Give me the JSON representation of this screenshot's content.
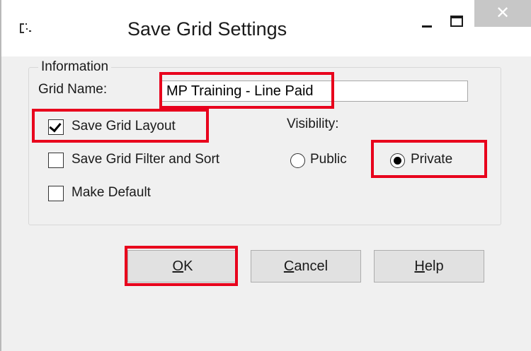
{
  "window": {
    "title": "Save Grid Settings",
    "close_glyph": "✕",
    "icon": "grid-settings-icon"
  },
  "information": {
    "legend": "Information",
    "grid_name_label": "Grid Name:",
    "grid_name_value": "MP Training - Line Paid"
  },
  "options": {
    "save_layout": {
      "label": "Save Grid Layout",
      "checked": true
    },
    "save_filter_sort": {
      "label": "Save Grid Filter and Sort",
      "checked": false
    },
    "make_default": {
      "label": "Make Default",
      "checked": false
    }
  },
  "visibility": {
    "label": "Visibility:",
    "public": {
      "label": "Public",
      "selected": false
    },
    "private": {
      "label": "Private",
      "selected": true
    }
  },
  "buttons": {
    "ok": {
      "mnemonic": "O",
      "rest": "K"
    },
    "cancel": {
      "mnemonic": "C",
      "rest": "ancel"
    },
    "help": {
      "mnemonic": "H",
      "rest": "elp"
    }
  },
  "highlight_color": "#e8001c"
}
